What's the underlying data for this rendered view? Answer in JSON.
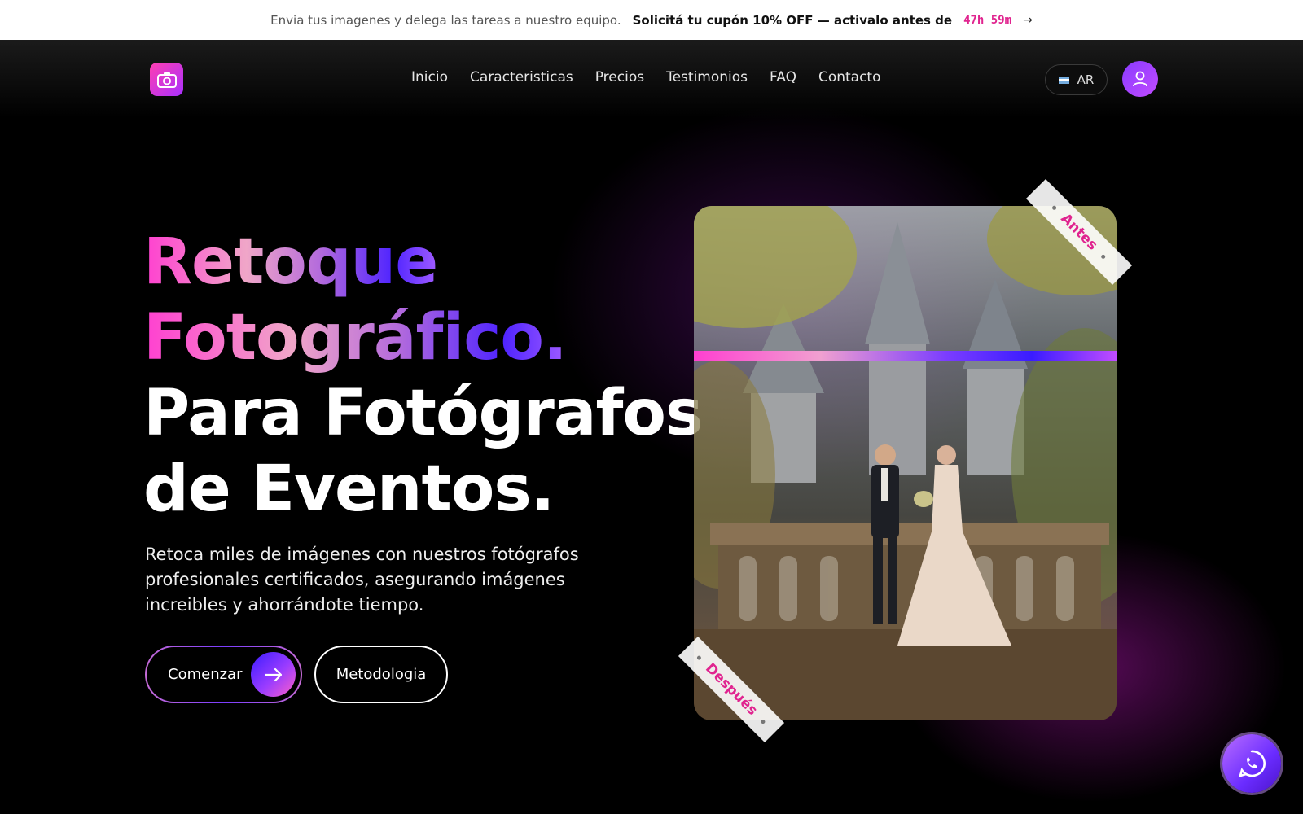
{
  "topbar": {
    "message": "Envia tus imagenes y delega las tareas a nuestro equipo.",
    "promo": "Solicitá tu cupón 10% OFF — activalo antes de",
    "timer": "47h 59m",
    "arrow": "→"
  },
  "nav": {
    "logo_icon": "camera-icon",
    "links": [
      "Inicio",
      "Caracteristicas",
      "Precios",
      "Testimonios",
      "FAQ",
      "Contacto"
    ],
    "language": "AR",
    "account_icon": "user-icon"
  },
  "hero": {
    "title_gradient_1": "Retoque",
    "title_gradient_2": "Fotográfico.",
    "title_white_1": "Para Fotógrafos",
    "title_white_2": "de Eventos.",
    "subtitle": "Retoca miles de imágenes con nuestros fotógrafos profesionales certificados, asegurando imágenes increibles y ahorrándote tiempo.",
    "primary_button": "Comenzar",
    "secondary_button": "Metodologia"
  },
  "photo": {
    "before_label": "Antes",
    "after_label": "Después"
  },
  "colors": {
    "accent_pink": "#e0248f",
    "accent_purple": "#7a3cff",
    "background": "#000000"
  },
  "floating": {
    "whatsapp_icon": "whatsapp-icon"
  }
}
